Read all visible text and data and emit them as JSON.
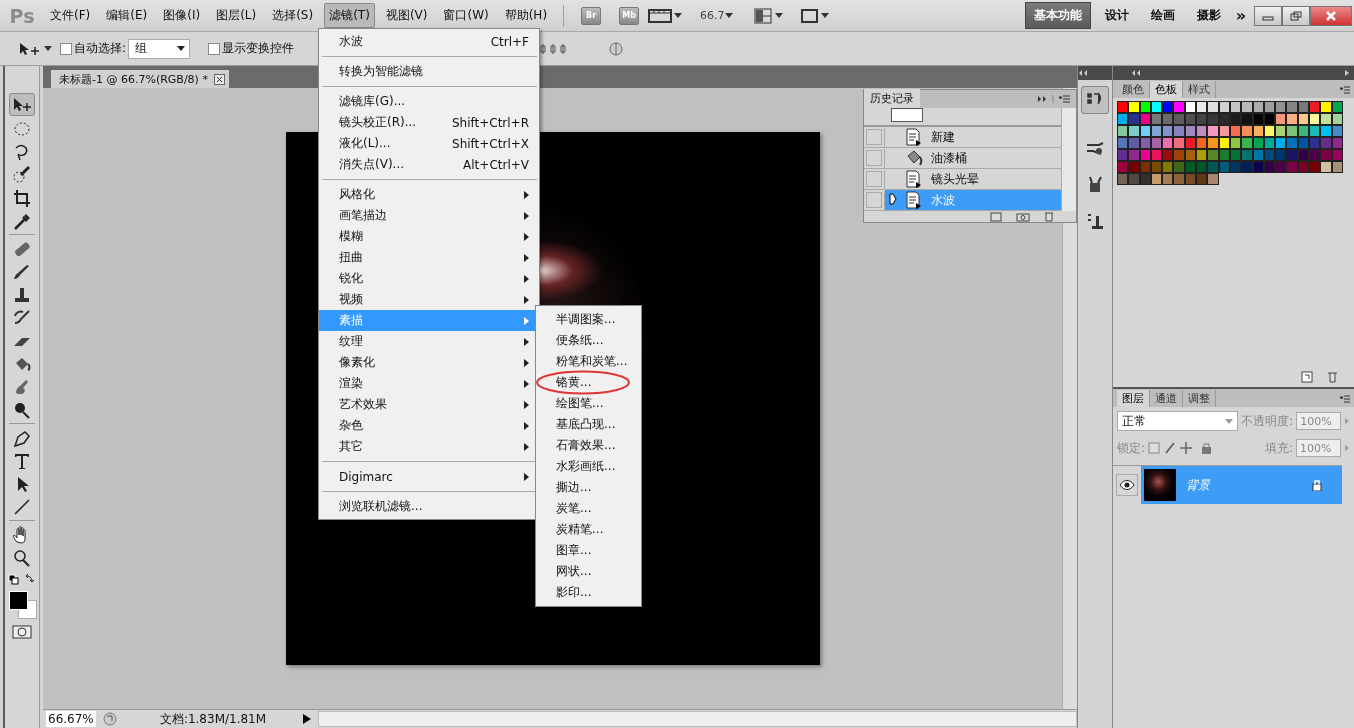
{
  "app": {
    "logo": "Ps"
  },
  "menubar": [
    {
      "label": "文件(F)",
      "selected": false
    },
    {
      "label": "编辑(E)",
      "selected": false
    },
    {
      "label": "图像(I)",
      "selected": false
    },
    {
      "label": "图层(L)",
      "selected": false
    },
    {
      "label": "选择(S)",
      "selected": false
    },
    {
      "label": "滤镜(T)",
      "selected": true
    },
    {
      "label": "视图(V)",
      "selected": false
    },
    {
      "label": "窗口(W)",
      "selected": false
    },
    {
      "label": "帮助(H)",
      "selected": false
    }
  ],
  "app_bar": {
    "bridge": "Br",
    "mini_bridge": "Mb",
    "zoom": "66.7"
  },
  "workspaces": [
    {
      "label": "基本功能",
      "selected": true
    },
    {
      "label": "设计",
      "selected": false
    },
    {
      "label": "绘画",
      "selected": false
    },
    {
      "label": "摄影",
      "selected": false
    }
  ],
  "workspace_more": "»",
  "options_bar": {
    "auto_select": {
      "label": "自动选择:",
      "checked": false
    },
    "auto_select_target": "组",
    "transform_controls": {
      "label": "显示变换控件",
      "checked": false
    }
  },
  "document": {
    "tab_title": "未标题-1 @ 66.7%(RGB/8) *",
    "zoom": "66.67%",
    "doc_info": "文档:1.83M/1.81M"
  },
  "history_panel": {
    "tab": "历史记录",
    "items": [
      {
        "label": "新建",
        "kind": "document",
        "checked": false,
        "selected": false
      },
      {
        "label": "油漆桶",
        "kind": "bucket",
        "checked": false,
        "selected": false
      },
      {
        "label": "镜头光晕",
        "kind": "document",
        "checked": false,
        "selected": false
      },
      {
        "label": "水波",
        "kind": "document",
        "checked": false,
        "selected": true
      }
    ]
  },
  "swatches_panel": {
    "tabs": [
      {
        "label": "颜色",
        "selected": false
      },
      {
        "label": "色板",
        "selected": true
      },
      {
        "label": "样式",
        "selected": false
      }
    ],
    "swatches": [
      {
        "color": "#ff0000"
      },
      {
        "color": "#ffff00"
      },
      {
        "color": "#00ff00"
      },
      {
        "color": "#00ffff"
      },
      {
        "color": "#0000ff"
      },
      {
        "color": "#ff00ff"
      },
      {
        "color": "#ffffff"
      },
      {
        "color": "#ebebeb"
      },
      {
        "color": "#dedede"
      },
      {
        "color": "#d1d1d1"
      },
      {
        "color": "#c4c4c4"
      },
      {
        "color": "#b8b8b8"
      },
      {
        "color": "#ababab"
      },
      {
        "color": "#9e9e9e"
      },
      {
        "color": "#919191"
      },
      {
        "color": "#858585"
      },
      {
        "color": "#787878"
      },
      {
        "color": "#ed1c24"
      },
      {
        "color": "#fff200"
      },
      {
        "color": "#00a651"
      },
      {
        "color": "#00aeef"
      },
      {
        "color": "#2e3192"
      },
      {
        "color": "#ec008c"
      },
      {
        "color": "#777777"
      },
      {
        "color": "#6a6a6a"
      },
      {
        "color": "#5d5d5d"
      },
      {
        "color": "#505050"
      },
      {
        "color": "#444444"
      },
      {
        "color": "#373737"
      },
      {
        "color": "#2a2a2a"
      },
      {
        "color": "#1d1d1d"
      },
      {
        "color": "#111111"
      },
      {
        "color": "#050505"
      },
      {
        "color": "#000000"
      },
      {
        "color": "#f7977a"
      },
      {
        "color": "#f9ad81"
      },
      {
        "color": "#fdc68a"
      },
      {
        "color": "#fff79a"
      },
      {
        "color": "#c4df9b"
      },
      {
        "color": "#a2d39c"
      },
      {
        "color": "#82ca9d"
      },
      {
        "color": "#7bcdc8"
      },
      {
        "color": "#6ecff6"
      },
      {
        "color": "#7ea7d8"
      },
      {
        "color": "#8493ca"
      },
      {
        "color": "#8882be"
      },
      {
        "color": "#a187be"
      },
      {
        "color": "#bc8dbf"
      },
      {
        "color": "#f49ac2"
      },
      {
        "color": "#f6989d"
      },
      {
        "color": "#f26c4f"
      },
      {
        "color": "#f68e55"
      },
      {
        "color": "#fbaf5c"
      },
      {
        "color": "#fff467"
      },
      {
        "color": "#acd372"
      },
      {
        "color": "#7cc576"
      },
      {
        "color": "#3bb878"
      },
      {
        "color": "#1abbb4"
      },
      {
        "color": "#00bff3"
      },
      {
        "color": "#438ccb"
      },
      {
        "color": "#5574b9"
      },
      {
        "color": "#605ca8"
      },
      {
        "color": "#855fa8"
      },
      {
        "color": "#a763a8"
      },
      {
        "color": "#f06ea9"
      },
      {
        "color": "#f26d7d"
      },
      {
        "color": "#ed1c24"
      },
      {
        "color": "#f26522"
      },
      {
        "color": "#f7941d"
      },
      {
        "color": "#fff200"
      },
      {
        "color": "#8dc63f"
      },
      {
        "color": "#39b54a"
      },
      {
        "color": "#00a651"
      },
      {
        "color": "#00a99d"
      },
      {
        "color": "#00aeef"
      },
      {
        "color": "#0072bc"
      },
      {
        "color": "#0054a6"
      },
      {
        "color": "#2e3192"
      },
      {
        "color": "#662d91"
      },
      {
        "color": "#92278f"
      },
      {
        "color": "#662d91"
      },
      {
        "color": "#92278f"
      },
      {
        "color": "#ec008c"
      },
      {
        "color": "#ed145b"
      },
      {
        "color": "#9e0b0f"
      },
      {
        "color": "#a0410d"
      },
      {
        "color": "#a36209"
      },
      {
        "color": "#aba000"
      },
      {
        "color": "#598527"
      },
      {
        "color": "#197b30"
      },
      {
        "color": "#007236"
      },
      {
        "color": "#00746b"
      },
      {
        "color": "#0076a3"
      },
      {
        "color": "#004a80"
      },
      {
        "color": "#003471"
      },
      {
        "color": "#1b1464"
      },
      {
        "color": "#32004b"
      },
      {
        "color": "#4b0049"
      },
      {
        "color": "#7b0046"
      },
      {
        "color": "#9e005d"
      },
      {
        "color": "#9e0039"
      },
      {
        "color": "#790000"
      },
      {
        "color": "#7b2e00"
      },
      {
        "color": "#7d4900"
      },
      {
        "color": "#827b00"
      },
      {
        "color": "#406618"
      },
      {
        "color": "#005e20"
      },
      {
        "color": "#005826"
      },
      {
        "color": "#005952"
      },
      {
        "color": "#005b7f"
      },
      {
        "color": "#003663"
      },
      {
        "color": "#002157"
      },
      {
        "color": "#0d004c"
      },
      {
        "color": "#32004b"
      },
      {
        "color": "#4b0049"
      },
      {
        "color": "#7b0046"
      },
      {
        "color": "#7a0026"
      },
      {
        "color": "#790000"
      },
      {
        "color": "#d4c0a1"
      },
      {
        "color": "#a39279"
      },
      {
        "color": "#736357"
      },
      {
        "color": "#534741"
      },
      {
        "color": "#362f2d"
      },
      {
        "color": "#c69c6d"
      },
      {
        "color": "#a67c52"
      },
      {
        "color": "#8c6239"
      },
      {
        "color": "#754c24"
      },
      {
        "color": "#603913"
      },
      {
        "color": "#a88670"
      }
    ]
  },
  "layers_panel": {
    "tabs": [
      {
        "label": "图层",
        "selected": true
      },
      {
        "label": "通道",
        "selected": false
      },
      {
        "label": "调整",
        "selected": false
      }
    ],
    "blend_mode": "正常",
    "opacity_label": "不透明度:",
    "opacity": "100%",
    "lock_label": "锁定:",
    "fill_label": "填充:",
    "fill": "100%",
    "layers": [
      {
        "name": "背景",
        "selected": true,
        "visible": true,
        "locked": true
      }
    ]
  },
  "filter_menu": {
    "items": [
      {
        "kind": "item",
        "label": "水波",
        "shortcut": "Ctrl+F",
        "selected": false
      },
      {
        "kind": "separator"
      },
      {
        "kind": "item",
        "label": "转换为智能滤镜",
        "selected": false
      },
      {
        "kind": "separator"
      },
      {
        "kind": "item",
        "label": "滤镜库(G)...",
        "selected": false
      },
      {
        "kind": "item",
        "label": "镜头校正(R)...",
        "shortcut": "Shift+Ctrl+R",
        "selected": false
      },
      {
        "kind": "item",
        "label": "液化(L)...",
        "shortcut": "Shift+Ctrl+X",
        "selected": false
      },
      {
        "kind": "item",
        "label": "消失点(V)...",
        "shortcut": "Alt+Ctrl+V",
        "selected": false
      },
      {
        "kind": "separator"
      },
      {
        "kind": "submenu",
        "label": "风格化",
        "selected": false
      },
      {
        "kind": "submenu",
        "label": "画笔描边",
        "selected": false
      },
      {
        "kind": "submenu",
        "label": "模糊",
        "selected": false
      },
      {
        "kind": "submenu",
        "label": "扭曲",
        "selected": false
      },
      {
        "kind": "submenu",
        "label": "锐化",
        "selected": false
      },
      {
        "kind": "submenu",
        "label": "视频",
        "selected": false
      },
      {
        "kind": "submenu",
        "label": "素描",
        "selected": true
      },
      {
        "kind": "submenu",
        "label": "纹理",
        "selected": false
      },
      {
        "kind": "submenu",
        "label": "像素化",
        "selected": false
      },
      {
        "kind": "submenu",
        "label": "渲染",
        "selected": false
      },
      {
        "kind": "submenu",
        "label": "艺术效果",
        "selected": false
      },
      {
        "kind": "submenu",
        "label": "杂色",
        "selected": false
      },
      {
        "kind": "submenu",
        "label": "其它",
        "selected": false
      },
      {
        "kind": "separator"
      },
      {
        "kind": "submenu",
        "label": "Digimarc",
        "selected": false
      },
      {
        "kind": "separator"
      },
      {
        "kind": "item",
        "label": "浏览联机滤镜...",
        "selected": false
      }
    ]
  },
  "sketch_submenu": {
    "items": [
      {
        "label": "半调图案...",
        "selected": false,
        "circled": false
      },
      {
        "label": "便条纸...",
        "selected": false,
        "circled": false
      },
      {
        "label": "粉笔和炭笔...",
        "selected": false,
        "circled": false
      },
      {
        "label": "铬黄...",
        "selected": false,
        "circled": true
      },
      {
        "label": "绘图笔...",
        "selected": false,
        "circled": false
      },
      {
        "label": "基底凸现...",
        "selected": false,
        "circled": false
      },
      {
        "label": "石膏效果...",
        "selected": false,
        "circled": false
      },
      {
        "label": "水彩画纸...",
        "selected": false,
        "circled": false
      },
      {
        "label": "撕边...",
        "selected": false,
        "circled": false
      },
      {
        "label": "炭笔...",
        "selected": false,
        "circled": false
      },
      {
        "label": "炭精笔...",
        "selected": false,
        "circled": false
      },
      {
        "label": "图章...",
        "selected": false,
        "circled": false
      },
      {
        "label": "网状...",
        "selected": false,
        "circled": false
      },
      {
        "label": "影印...",
        "selected": false,
        "circled": false
      }
    ]
  }
}
